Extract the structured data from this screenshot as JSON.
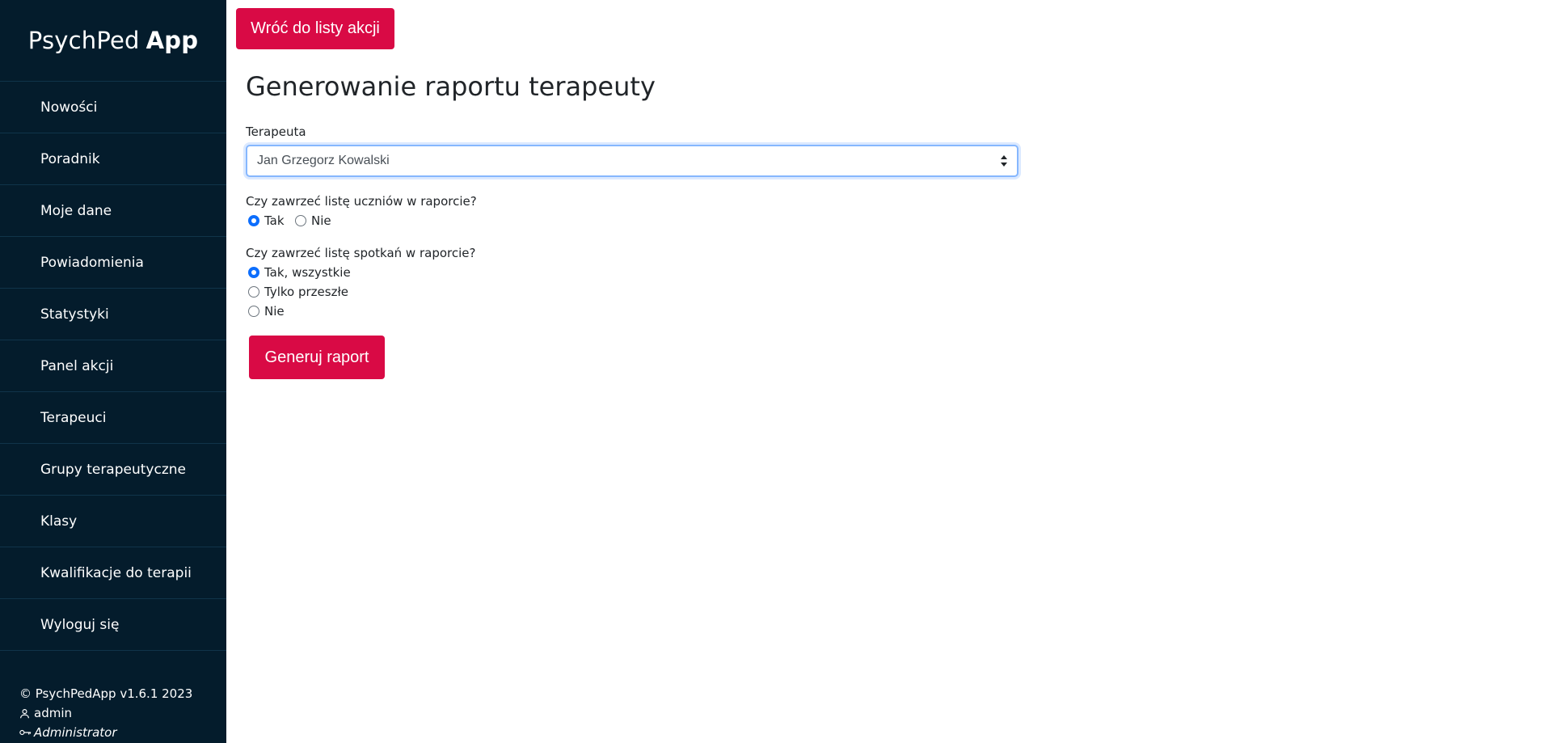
{
  "brand": {
    "light": "PsychPed",
    "bold": "App"
  },
  "sidebar": {
    "items": [
      {
        "label": "Nowości"
      },
      {
        "label": "Poradnik"
      },
      {
        "label": "Moje dane"
      },
      {
        "label": "Powiadomienia"
      },
      {
        "label": "Statystyki"
      },
      {
        "label": "Panel akcji"
      },
      {
        "label": "Terapeuci"
      },
      {
        "label": "Grupy terapeutyczne"
      },
      {
        "label": "Klasy"
      },
      {
        "label": "Kwalifikacje do terapii"
      },
      {
        "label": "Wyloguj się"
      }
    ],
    "footer": {
      "copyright": "© PsychPedApp v1.6.1 2023",
      "user": "admin",
      "role": "Administrator",
      "user_icon": "user-icon",
      "role_icon": "key-icon"
    }
  },
  "main": {
    "back_button_label": "Wróć do listy akcji",
    "title": "Generowanie raportu terapeuty",
    "therapist_label": "Terapeuta",
    "therapist_value": "Jan Grzegorz Kowalski",
    "students_question": "Czy zawrzeć listę uczniów w raporcie?",
    "students_options": [
      "Tak",
      "Nie"
    ],
    "students_selected": "Tak",
    "meetings_question": "Czy zawrzeć listę spotkań w raporcie?",
    "meetings_options": [
      "Tak, wszystkie",
      "Tylko przeszłe",
      "Nie"
    ],
    "meetings_selected": "Tak, wszystkie",
    "generate_button_label": "Generuj raport"
  },
  "colors": {
    "sidebar_bg": "#041c2c",
    "accent": "#d90a45",
    "radio_checked": "#0d6efd",
    "select_focus": "#86b7fe"
  }
}
